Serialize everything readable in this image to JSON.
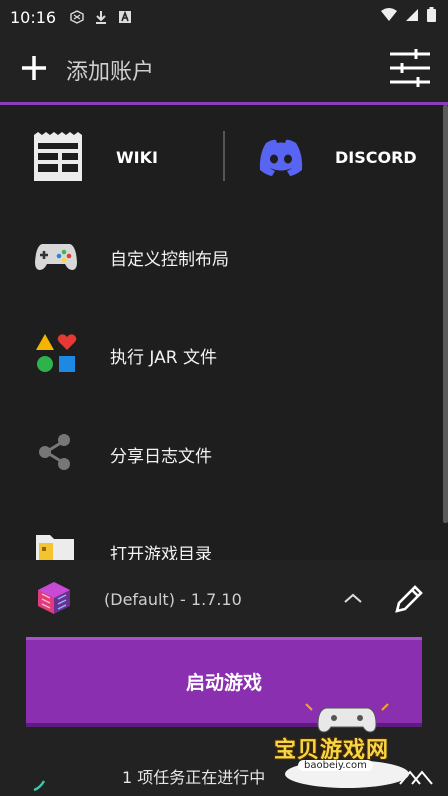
{
  "status_bar": {
    "time": "10:16"
  },
  "toolbar": {
    "title": "添加账户"
  },
  "links": {
    "wiki_label": "WIKI",
    "discord_label": "DISCORD"
  },
  "menu": {
    "items": [
      {
        "label": "自定义控制布局",
        "icon": "gamepad-icon"
      },
      {
        "label": "执行 JAR 文件",
        "icon": "shapes-icon"
      },
      {
        "label": "分享日志文件",
        "icon": "share-icon"
      },
      {
        "label": "打开游戏目录",
        "icon": "folder-icon"
      }
    ]
  },
  "profile": {
    "version": "(Default) - 1.7.10"
  },
  "play_button": {
    "label": "启动游戏"
  },
  "tasks": {
    "text": "1 项任务正在进行中"
  },
  "watermark": {
    "text": "宝贝游戏网",
    "url": "baobeiy.com"
  },
  "colors": {
    "accent": "#8c3db9",
    "play": "#8a2fb0",
    "discord": "#5865f2",
    "background": "#1e1e1e"
  }
}
